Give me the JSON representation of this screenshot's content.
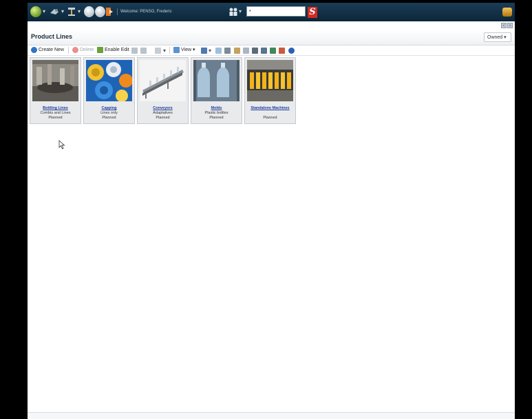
{
  "topbar": {
    "welcome": "Welcome: PENSO, Frederic",
    "search_value": "*",
    "logo_letter": "S",
    "icons": [
      "globe-icon",
      "bookmark-icon",
      "tools-icon",
      "back-icon",
      "forward-icon",
      "exit-icon",
      "user-icon"
    ]
  },
  "subbar": {
    "prev": "<",
    "next": ">"
  },
  "page": {
    "title": "Product Lines",
    "filter_value": "Owned ▾"
  },
  "toolbar": {
    "create_new": "Create New",
    "delete": "Delete",
    "enable_edit": "Enable Edit",
    "view": "View"
  },
  "tiles": [
    {
      "title": "Bottling Lines",
      "subtitle": "Combis and Lines",
      "status": "Planned"
    },
    {
      "title": "Capping",
      "subtitle": "Lines only",
      "status": "Planned"
    },
    {
      "title": "Conveyors",
      "subtitle": "Adaptatives",
      "status": "Planned"
    },
    {
      "title": "Molds",
      "subtitle": "Plastic bottles",
      "status": "Planned"
    },
    {
      "title": "Standalone Machines",
      "subtitle": "",
      "status": "Planned"
    }
  ],
  "colors": {
    "topbar": "#0c2639",
    "link": "#18389a",
    "logo": "#d42a20"
  }
}
